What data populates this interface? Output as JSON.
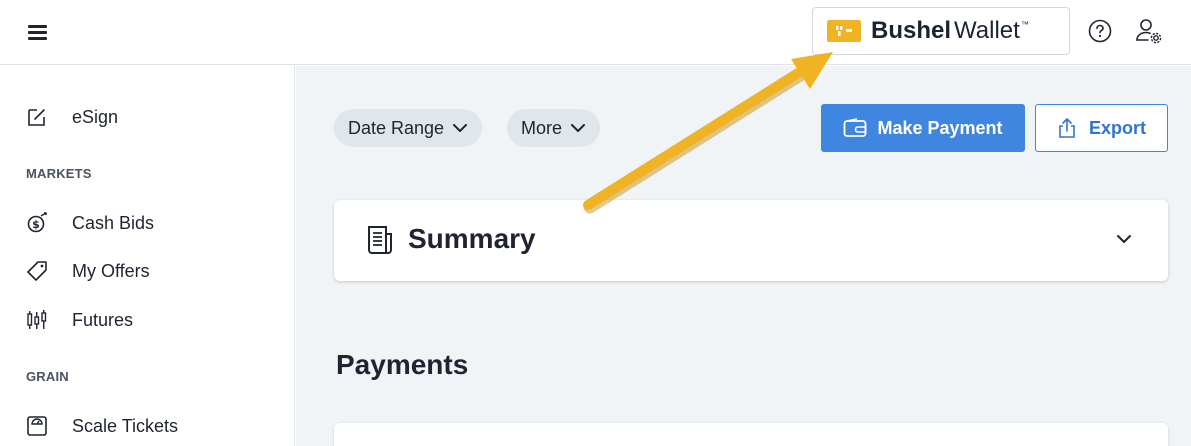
{
  "header": {
    "wallet_brand": "Bushel",
    "wallet_word": "Wallet",
    "wallet_logo_color": "#f0b324",
    "icons": [
      "hamburger-menu-icon",
      "help-icon",
      "user-settings-icon"
    ]
  },
  "sidebar": {
    "items": [
      {
        "label": "eSign",
        "icon": "edit-icon"
      },
      {
        "label": "Cash Bids",
        "icon": "dollar-coin-icon"
      },
      {
        "label": "My Offers",
        "icon": "tag-icon"
      },
      {
        "label": "Futures",
        "icon": "candlestick-icon"
      },
      {
        "label": "Scale Tickets",
        "icon": "scale-icon"
      }
    ],
    "sections": [
      "MARKETS",
      "GRAIN"
    ]
  },
  "filters": {
    "date_range_label": "Date Range",
    "more_label": "More"
  },
  "actions": {
    "make_payment_label": "Make Payment",
    "export_label": "Export",
    "accent_color": "#3f86e0"
  },
  "summary": {
    "title": "Summary"
  },
  "payments": {
    "title": "Payments"
  },
  "annotation": {
    "arrow_color": "#f0b324"
  }
}
